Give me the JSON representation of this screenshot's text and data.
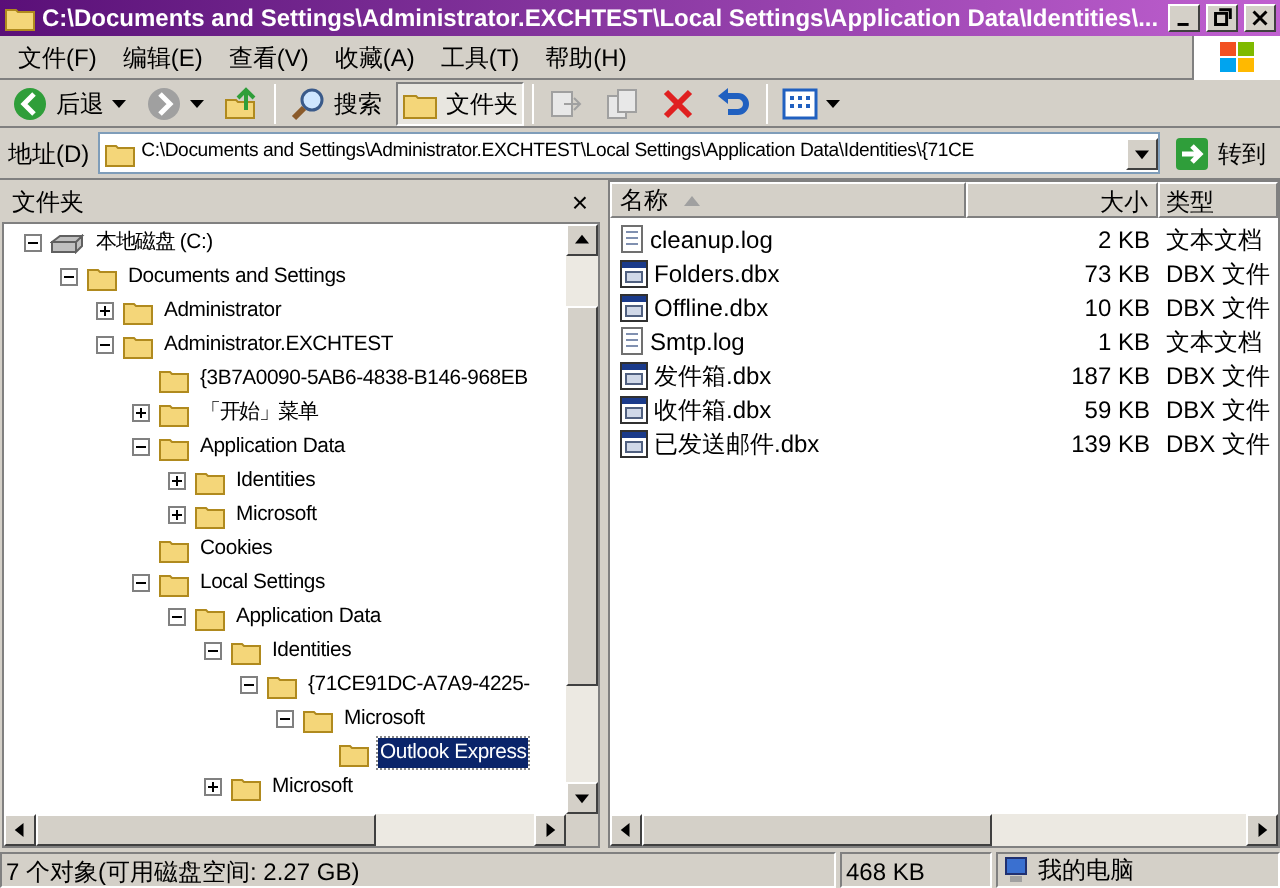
{
  "window": {
    "title": "C:\\Documents and Settings\\Administrator.EXCHTEST\\Local Settings\\Application Data\\Identities\\..."
  },
  "menu": [
    "文件(F)",
    "编辑(E)",
    "查看(V)",
    "收藏(A)",
    "工具(T)",
    "帮助(H)"
  ],
  "toolbar": [
    {
      "kind": "back",
      "label": "后退",
      "disabled": false,
      "selected": false
    },
    {
      "kind": "forward",
      "disabled": true,
      "selected": false
    },
    {
      "kind": "up",
      "disabled": false,
      "selected": false
    },
    {
      "kind": "search",
      "label": "搜索",
      "disabled": false,
      "selected": false
    },
    {
      "kind": "folders",
      "label": "文件夹",
      "disabled": false,
      "selected": true
    },
    {
      "kind": "move",
      "disabled": true,
      "selected": false
    },
    {
      "kind": "copy",
      "disabled": true,
      "selected": false
    },
    {
      "kind": "delete",
      "disabled": false,
      "selected": false
    },
    {
      "kind": "undo",
      "disabled": false,
      "selected": false
    },
    {
      "kind": "views",
      "disabled": false,
      "selected": false
    }
  ],
  "address": {
    "label": "地址(D)",
    "value": "C:\\Documents and Settings\\Administrator.EXCHTEST\\Local Settings\\Application Data\\Identities\\{71CE",
    "go": "转到"
  },
  "folder_pane": {
    "title": "文件夹",
    "close": "×",
    "tree": [
      {
        "label": "本地磁盘 (C:)",
        "kind": "drive",
        "expandable": true,
        "expanded": true,
        "selected": false,
        "children": [
          {
            "label": "Documents and Settings",
            "kind": "folder",
            "expandable": true,
            "expanded": true,
            "selected": false,
            "children": [
              {
                "label": "Administrator",
                "kind": "folder",
                "expandable": true,
                "expanded": false,
                "selected": false
              },
              {
                "label": "Administrator.EXCHTEST",
                "kind": "folder",
                "expandable": true,
                "expanded": true,
                "selected": false,
                "children": [
                  {
                    "label": "{3B7A0090-5AB6-4838-B146-968EB",
                    "kind": "folder",
                    "expandable": false,
                    "selected": false
                  },
                  {
                    "label": "「开始」菜单",
                    "kind": "folder",
                    "expandable": true,
                    "expanded": false,
                    "selected": false
                  },
                  {
                    "label": "Application Data",
                    "kind": "folder",
                    "expandable": true,
                    "expanded": true,
                    "selected": false,
                    "children": [
                      {
                        "label": "Identities",
                        "kind": "folder",
                        "expandable": true,
                        "expanded": false,
                        "selected": false
                      },
                      {
                        "label": "Microsoft",
                        "kind": "folder",
                        "expandable": true,
                        "expanded": false,
                        "selected": false
                      }
                    ]
                  },
                  {
                    "label": "Cookies",
                    "kind": "folder",
                    "expandable": false,
                    "selected": false
                  },
                  {
                    "label": "Local Settings",
                    "kind": "folder",
                    "expandable": true,
                    "expanded": true,
                    "selected": false,
                    "children": [
                      {
                        "label": "Application Data",
                        "kind": "folder",
                        "expandable": true,
                        "expanded": true,
                        "selected": false,
                        "children": [
                          {
                            "label": "Identities",
                            "kind": "folder",
                            "expandable": true,
                            "expanded": true,
                            "selected": false,
                            "children": [
                              {
                                "label": "{71CE91DC-A7A9-4225-",
                                "kind": "folder",
                                "expandable": true,
                                "expanded": true,
                                "selected": false,
                                "children": [
                                  {
                                    "label": "Microsoft",
                                    "kind": "folder",
                                    "expandable": true,
                                    "expanded": true,
                                    "selected": false,
                                    "children": [
                                      {
                                        "label": "Outlook Express",
                                        "kind": "folder",
                                        "expandable": false,
                                        "selected": true
                                      }
                                    ]
                                  }
                                ]
                              }
                            ]
                          },
                          {
                            "label": "Microsoft",
                            "kind": "folder",
                            "expandable": true,
                            "expanded": false,
                            "selected": false
                          }
                        ]
                      }
                    ]
                  }
                ]
              }
            ]
          }
        ]
      }
    ]
  },
  "file_list": {
    "columns": [
      "名称",
      "大小",
      "类型"
    ],
    "rows": [
      {
        "name": "cleanup.log",
        "size": "2 KB",
        "type": "文本文档",
        "kind": "text"
      },
      {
        "name": "Folders.dbx",
        "size": "73 KB",
        "type": "DBX 文件",
        "kind": "dbx"
      },
      {
        "name": "Offline.dbx",
        "size": "10 KB",
        "type": "DBX 文件",
        "kind": "dbx"
      },
      {
        "name": "Smtp.log",
        "size": "1 KB",
        "type": "文本文档",
        "kind": "text"
      },
      {
        "name": "发件箱.dbx",
        "size": "187 KB",
        "type": "DBX 文件",
        "kind": "dbx"
      },
      {
        "name": "收件箱.dbx",
        "size": "59 KB",
        "type": "DBX 文件",
        "kind": "dbx"
      },
      {
        "name": "已发送邮件.dbx",
        "size": "139 KB",
        "type": "DBX 文件",
        "kind": "dbx"
      }
    ]
  },
  "status_bar": {
    "objects": "7 个对象(可用磁盘空间: 2.27 GB)",
    "size": "468 KB",
    "zone": "我的电脑"
  }
}
